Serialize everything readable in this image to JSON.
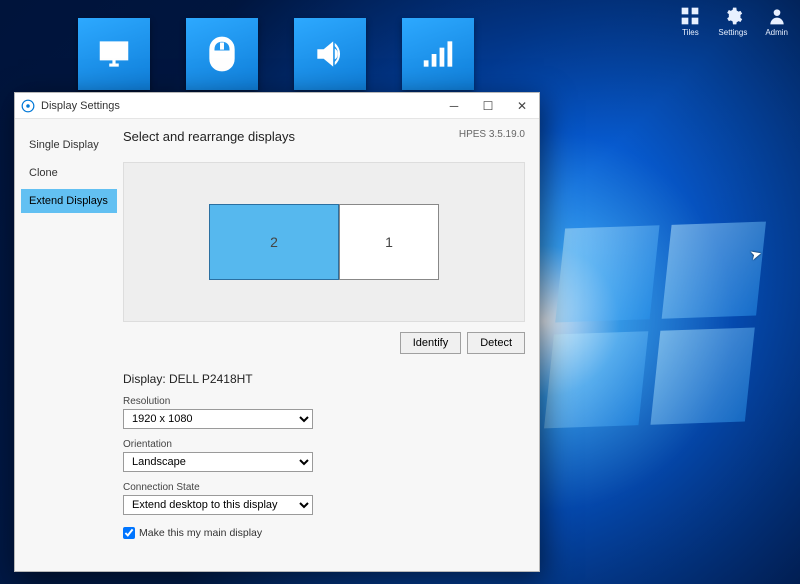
{
  "tray": {
    "items": [
      {
        "name": "tiles",
        "label": "Tiles"
      },
      {
        "name": "settings",
        "label": "Settings"
      },
      {
        "name": "admin",
        "label": "Admin"
      }
    ]
  },
  "tiles": [
    {
      "name": "display",
      "label": "Display"
    },
    {
      "name": "mouse",
      "label": "Mouse"
    },
    {
      "name": "sound",
      "label": "Sound"
    },
    {
      "name": "network",
      "label": "Network"
    }
  ],
  "window": {
    "title": "Display Settings",
    "version": "HPES 3.5.19.0",
    "sidebar": {
      "items": [
        {
          "label": "Single Display",
          "selected": false
        },
        {
          "label": "Clone",
          "selected": false
        },
        {
          "label": "Extend Displays",
          "selected": true
        }
      ]
    },
    "main": {
      "heading": "Select and rearrange displays",
      "displays": [
        {
          "id": "2",
          "primary": true
        },
        {
          "id": "1",
          "primary": false
        }
      ],
      "identify_label": "Identify",
      "detect_label": "Detect",
      "display_label_prefix": "Display: ",
      "display_name": "DELL P2418HT",
      "resolution_label": "Resolution",
      "resolution_value": "1920 x 1080",
      "orientation_label": "Orientation",
      "orientation_value": "Landscape",
      "connection_label": "Connection State",
      "connection_value": "Extend desktop to this display",
      "main_display_checkbox_label": "Make this my main display",
      "main_display_checked": true
    }
  }
}
